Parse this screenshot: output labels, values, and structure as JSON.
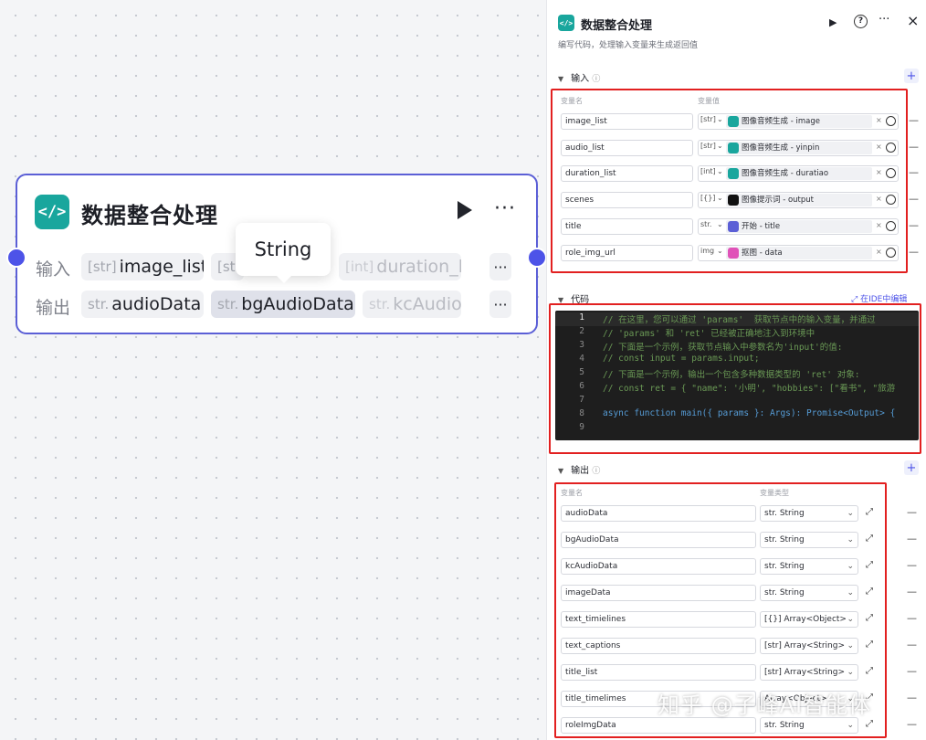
{
  "node": {
    "icon": "</>",
    "title": "数据整合处理",
    "input_label": "输入",
    "output_label": "输出",
    "inputs": [
      {
        "type": "[str]",
        "name": "image_list"
      },
      {
        "type": "[str]",
        "name": ""
      },
      {
        "type": "[int]",
        "name": "duration_li"
      }
    ],
    "outputs": [
      {
        "type": "str.",
        "name": "audioData"
      },
      {
        "type": "str.",
        "name": "bgAudioData"
      },
      {
        "type": "str.",
        "name": "kcAudio"
      }
    ],
    "more": "···"
  },
  "tooltip": "String",
  "panel": {
    "icon": "</>",
    "title": "数据整合处理",
    "description": "编写代码，处理输入变量来生成返回值",
    "run_icon": "▶",
    "help_icon": "?",
    "more_icon": "···",
    "close_icon": "×",
    "input_section": {
      "title": "输入",
      "col_name": "变量名",
      "col_value": "变量值",
      "rows": [
        {
          "name": "image_list",
          "type": "[str]",
          "ref": "图像音频生成 - image",
          "ref_color": "#19a69d"
        },
        {
          "name": "audio_list",
          "type": "[str]",
          "ref": "图像音频生成 - yinpin",
          "ref_color": "#19a69d"
        },
        {
          "name": "duration_list",
          "type": "[int]",
          "ref": "图像音频生成 - duratiao",
          "ref_color": "#19a69d"
        },
        {
          "name": "scenes",
          "type": "[{}]",
          "ref": "图像提示词 - output",
          "ref_color": "#111111"
        },
        {
          "name": "title",
          "type": "str.",
          "ref": "开始 - title",
          "ref_color": "#5b5fd6"
        },
        {
          "name": "role_img_url",
          "type": "img",
          "ref": "抠图 - data",
          "ref_color": "#e052b8"
        }
      ]
    },
    "code_section": {
      "title": "代码",
      "ide_link": "在IDE中编辑",
      "lines": [
        "// 在这里，您可以通过 'params'  获取节点中的输入变量，并通过",
        "// 'params' 和 'ret' 已经被正确地注入到环境中",
        "// 下面是一个示例，获取节点输入中参数名为'input'的值:",
        "// const input = params.input;",
        "// 下面是一个示例，输出一个包含多种数据类型的 'ret' 对象:",
        "// const ret = { \"name\": '小明', \"hobbies\": [\"看书\", \"旅游",
        "",
        "async function main({ params }: Args): Promise<Output> {",
        ""
      ],
      "line_numbers": [
        "1",
        "2",
        "3",
        "4",
        "5",
        "6",
        "7",
        "8",
        "9"
      ]
    },
    "output_section": {
      "title": "输出",
      "col_name": "变量名",
      "col_type": "变量类型",
      "rows": [
        {
          "name": "audioData",
          "type": "str. String"
        },
        {
          "name": "bgAudioData",
          "type": "str. String"
        },
        {
          "name": "kcAudioData",
          "type": "str. String"
        },
        {
          "name": "imageData",
          "type": "str. String"
        },
        {
          "name": "text_timielines",
          "type": "[{}] Array<Object>"
        },
        {
          "name": "text_captions",
          "type": "[str] Array<String>"
        },
        {
          "name": "title_list",
          "type": "[str] Array<String>"
        },
        {
          "name": "title_timelimes",
          "type": "Array<Object>"
        },
        {
          "name": "roleImgData",
          "type": "str. String"
        }
      ]
    }
  },
  "watermark": "知乎 @子峰AI智能体"
}
